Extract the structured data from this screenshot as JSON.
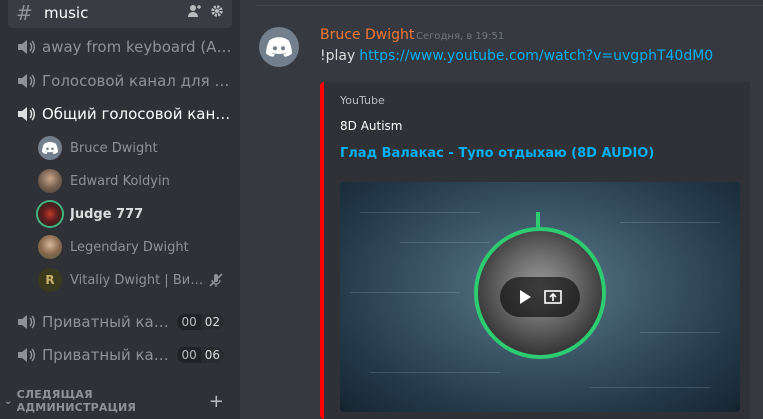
{
  "sidebar": {
    "text_channel": {
      "name": "music",
      "icon": "hash-icon"
    },
    "voice_channels": [
      {
        "name": "away from keyboard (AFK)"
      },
      {
        "name": "Голосовой канал для со..."
      },
      {
        "name": "Общий голосовой канал"
      }
    ],
    "voice_users": [
      {
        "name": "Bruce Dwight",
        "avatar": "discord-logo"
      },
      {
        "name": "Edward Koldyin",
        "avatar": "photo"
      },
      {
        "name": "Judge 777",
        "avatar": "photo",
        "speaking": true
      },
      {
        "name": "Legendary Dwight",
        "avatar": "photo"
      },
      {
        "name": "Vitaliy Dwight | Вит...",
        "avatar": "letter",
        "letter": "R",
        "muted": true
      }
    ],
    "private_channels": [
      {
        "name": "Приватный канал...",
        "count_left": "00",
        "count_right": "02"
      },
      {
        "name": "Приватный канал...",
        "count_left": "00",
        "count_right": "06"
      }
    ],
    "category": {
      "name": "СЛЕДЯЩАЯ АДМИНИСТРАЦИЯ"
    }
  },
  "message": {
    "author": "Bruce Dwight",
    "timestamp": "Сегодня, в 19:51",
    "command": "!play",
    "link": "https://www.youtube.com/watch?v=uvgphT40dM0",
    "author_color": "#f57731"
  },
  "embed": {
    "provider": "YouTube",
    "author": "8D Autism",
    "title": "Глад Валакас - Тупо отдыхаю (8D AUDIO)",
    "accent": "#ff0000"
  },
  "colors": {
    "sidebar_bg": "#2f3136",
    "main_bg": "#36393f",
    "link": "#00b0f4",
    "speaking": "#43b581"
  }
}
